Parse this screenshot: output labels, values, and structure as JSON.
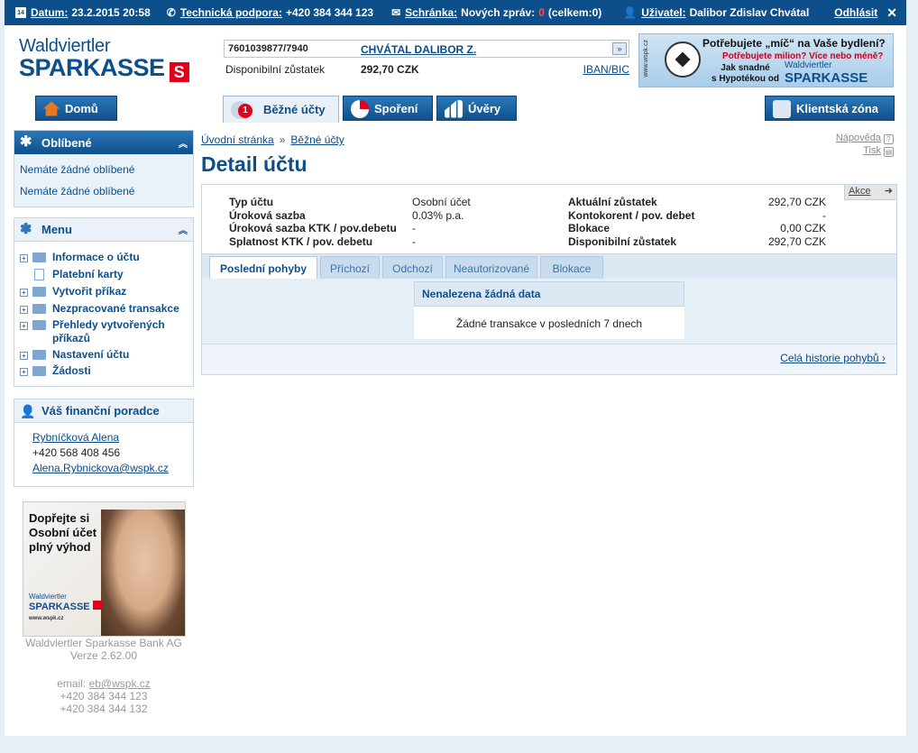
{
  "topbar": {
    "date_label": "Datum:",
    "date_value": "23.2.2015 20:58",
    "support_label": "Technická podpora:",
    "support_value": "+420 384 344 123",
    "inbox_label": "Schránka:",
    "inbox_text_a": "Nových zpráv:",
    "inbox_new": "0",
    "inbox_text_b": "(celkem:0)",
    "user_label": "Uživatel:",
    "user_name": "Dalibor Zdislav Chvátal",
    "logout": "Odhlásit",
    "calendar_day": "14"
  },
  "logo": {
    "line1": "Waldviertler",
    "line2": "SPARKASSE",
    "mark": "S"
  },
  "account": {
    "number": "7601039877/7940",
    "holder": "CHVÁTAL DALIBOR Z.",
    "available_label": "Disponibilní zůstatek",
    "available_value": "292,70 CZK",
    "iban_link": "IBAN/BIC"
  },
  "banner": {
    "line1": "Potřebujete „míč“ na Vaše bydlení?",
    "line2": "Potřebujete milion? Více nebo méně?",
    "line3": "Jak snadné",
    "line4": "s Hypotékou od",
    "brand1": "Waldviertler",
    "brand2": "SPARKASSE",
    "url": "www.wspk.cz"
  },
  "nav": {
    "home": "Domů",
    "current": "Běžné účty",
    "current_badge": "1",
    "savings": "Spoření",
    "loans": "Úvěry",
    "client": "Klientská zóna"
  },
  "favorites": {
    "title": "Oblíbené",
    "items": [
      "Nemáte žádné oblíbené",
      "Nemáte žádné oblíbené"
    ]
  },
  "menu": {
    "title": "Menu",
    "items": [
      {
        "label": "Informace o účtu"
      },
      {
        "label": "Platební karty"
      },
      {
        "label": "Vytvořit příkaz"
      },
      {
        "label": "Nezpracované transakce"
      },
      {
        "label": "Přehledy vytvořených"
      },
      {
        "label": "příkazů"
      },
      {
        "label": "Nastavení účtu"
      },
      {
        "label": "Žádosti"
      }
    ]
  },
  "advisor": {
    "title": "Váš finanční poradce",
    "name": "Rybníčková Alena",
    "phone": "+420 568 408 456",
    "email": "Alena.Rybnickova@wspk.cz"
  },
  "promo": {
    "line1": "Dopřejte si",
    "line2": "Osobní účet",
    "line3": "plný výhod",
    "brand1": "Waldviertler",
    "brand2": "SPARKASSE",
    "url": "www.wspk.cz"
  },
  "footer": {
    "bank": "Waldviertler Sparkasse Bank AG",
    "version": "Verze 2.62.00",
    "email_label": "email:",
    "email": "eb@wspk.cz",
    "phone1": "+420 384 344 123",
    "phone2": "+420 384 344 132"
  },
  "breadcrumb": {
    "home": "Úvodní stránka",
    "sep": "»",
    "current": "Běžné účty"
  },
  "help": {
    "help": "Nápověda",
    "print": "Tisk"
  },
  "page_title": "Detail účtu",
  "detail": {
    "action": "Akce",
    "left_labels": [
      "Typ účtu",
      "Úroková sazba",
      "Úroková sazba KTK / pov.debetu",
      "Splatnost KTK / pov. debetu"
    ],
    "left_values": [
      "Osobní účet",
      "0.03% p.a.",
      "-",
      "-"
    ],
    "right_labels": [
      "Aktuální zůstatek",
      "Kontokorent / pov. debet",
      "Blokace",
      "Disponibilní zůstatek"
    ],
    "right_values": [
      "292,70 CZK",
      "-",
      "0,00 CZK",
      "292,70 CZK"
    ]
  },
  "tabs": [
    "Poslední pohyby",
    "Příchozí",
    "Odchozí",
    "Neautorizované",
    "Blokace"
  ],
  "nodata": {
    "title": "Nenalezena žádná data",
    "text": "Žádné transakce v posledních 7 dnech"
  },
  "history_link": "Celá historie pohybů ›",
  "colors": {
    "primary": "#0d4f8b",
    "brand_red": "#e2001a",
    "panel_bg": "#e9f1f9"
  }
}
